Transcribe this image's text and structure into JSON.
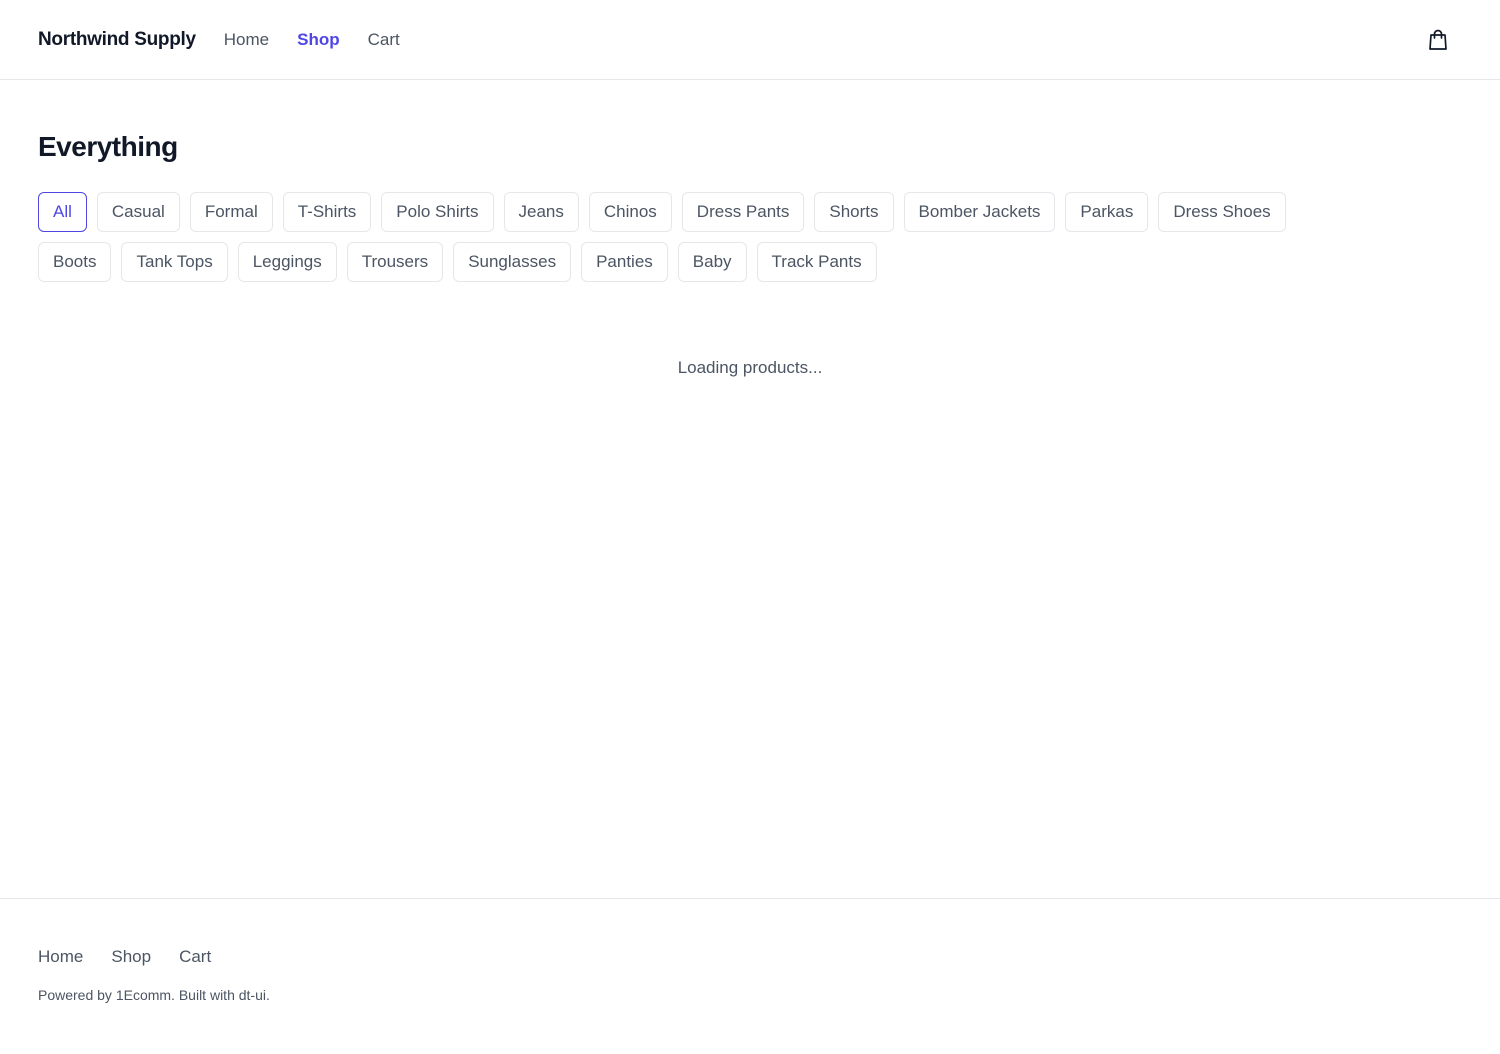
{
  "header": {
    "brand": "Northwind Supply",
    "nav": [
      {
        "label": "Home",
        "active": false
      },
      {
        "label": "Shop",
        "active": true
      },
      {
        "label": "Cart",
        "active": false
      }
    ],
    "cart_icon": "shopping-bag-icon"
  },
  "main": {
    "title": "Everything",
    "categories": [
      {
        "label": "All",
        "active": true
      },
      {
        "label": "Casual"
      },
      {
        "label": "Formal"
      },
      {
        "label": "T-Shirts"
      },
      {
        "label": "Polo Shirts"
      },
      {
        "label": "Jeans"
      },
      {
        "label": "Chinos"
      },
      {
        "label": "Dress Pants"
      },
      {
        "label": "Shorts"
      },
      {
        "label": "Bomber Jackets"
      },
      {
        "label": "Parkas"
      },
      {
        "label": "Dress Shoes"
      },
      {
        "label": "Boots"
      },
      {
        "label": "Tank Tops"
      },
      {
        "label": "Leggings"
      },
      {
        "label": "Trousers"
      },
      {
        "label": "Sunglasses"
      },
      {
        "label": "Panties"
      },
      {
        "label": "Baby"
      },
      {
        "label": "Track Pants"
      }
    ],
    "loading_text": "Loading products..."
  },
  "footer": {
    "nav": [
      {
        "label": "Home"
      },
      {
        "label": "Shop"
      },
      {
        "label": "Cart"
      }
    ],
    "note": "Powered by 1Ecomm. Built with dt-ui."
  },
  "colors": {
    "accent": "#4f46e5",
    "text": "#111827",
    "muted": "#4b5563",
    "border": "#e5e7eb"
  }
}
